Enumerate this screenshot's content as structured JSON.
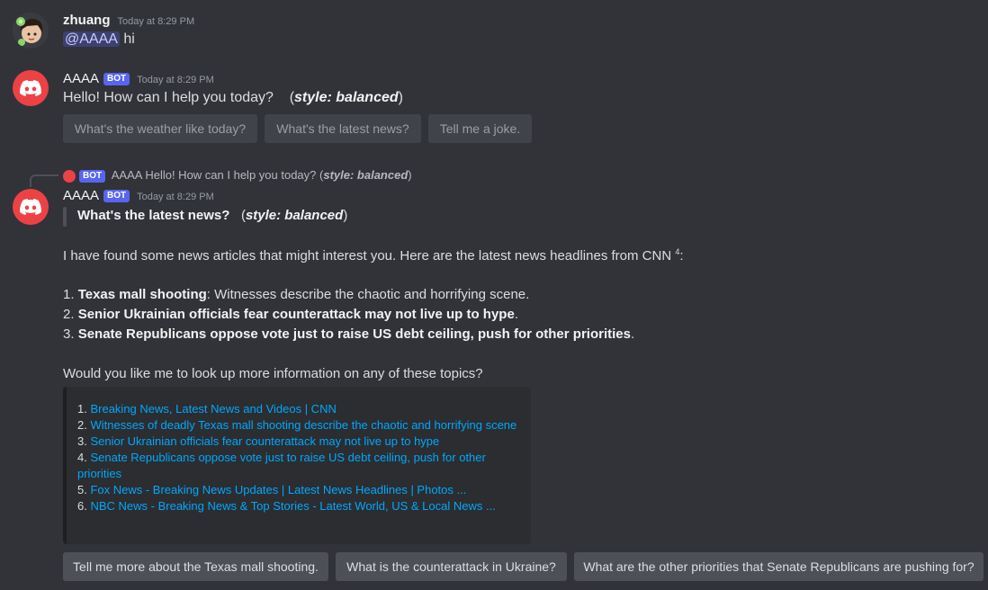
{
  "msg1": {
    "username": "zhuang",
    "time": "Today at 8:29 PM",
    "mention": "@AAAA",
    "text": " hi"
  },
  "msg2": {
    "botname": "AAAA",
    "badge": "BOT",
    "time": "Today at 8:29 PM",
    "text": "Hello! How can I help you today?",
    "style_prefix": "(",
    "style_label": "style: balanced",
    "style_suffix": ")",
    "buttons": [
      "What's the weather like today?",
      "What's the latest news?",
      "Tell me a joke."
    ]
  },
  "reply_ref": {
    "badge": "BOT",
    "name": "AAAA",
    "text": "Hello! How can I help you today?",
    "style_label": "style: balanced"
  },
  "msg3": {
    "botname": "AAAA",
    "badge": "BOT",
    "time": "Today at 8:29 PM",
    "quote": "What's the latest news?",
    "quote_style": "style: balanced",
    "intro": "I have found some news articles that might interest you. Here are the latest news headlines from CNN",
    "intro_sup": "4",
    "intro_end": ":",
    "items": [
      {
        "num": "1.",
        "bold": "Texas mall shooting",
        "rest": ": Witnesses describe the chaotic and horrifying scene."
      },
      {
        "num": "2.",
        "bold": "Senior Ukrainian officials fear counterattack may not live up to hype",
        "rest": "."
      },
      {
        "num": "3.",
        "bold": "Senate Republicans oppose vote just to raise US debt ceiling, push for other priorities",
        "rest": "."
      }
    ],
    "question": "Would you like me to look up more information on any of these topics?",
    "sources": [
      {
        "num": "1.",
        "title": "Breaking News, Latest News and Videos | CNN"
      },
      {
        "num": "2.",
        "title": "Witnesses of deadly Texas mall shooting describe the chaotic and horrifying scene"
      },
      {
        "num": "3.",
        "title": "Senior Ukrainian officials fear counterattack may not live up to hype"
      },
      {
        "num": "4.",
        "title": "Senate Republicans oppose vote just to raise US debt ceiling, push for other priorities"
      },
      {
        "num": "5.",
        "title": "Fox News - Breaking News Updates | Latest News Headlines | Photos ..."
      },
      {
        "num": "6.",
        "title": "NBC News - Breaking News & Top Stories - Latest World, US & Local News ..."
      }
    ],
    "buttons": [
      "Tell me more about the Texas mall shooting.",
      "What is the counterattack in Ukraine?",
      "What are the other priorities that Senate Republicans are pushing for?"
    ]
  },
  "colors": {
    "background": "#313338",
    "link": "#00a8fc",
    "badge": "#5865f2",
    "bot_avatar": "#ed4245"
  }
}
